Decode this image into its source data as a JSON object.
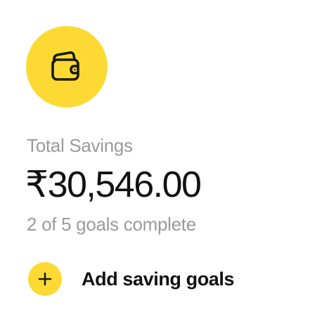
{
  "savings": {
    "icon": "wallet-icon",
    "label": "Total Savings",
    "amount": "₹30,546.00",
    "goals_completed": 2,
    "goals_total": 5,
    "goals_status": "2 of 5 goals complete"
  },
  "add_goal": {
    "icon": "plus-icon",
    "label": "Add saving goals"
  },
  "colors": {
    "accent": "#FDDA33",
    "text_primary": "#111111",
    "text_secondary": "#9A9A9A",
    "background": "#FFFFFF"
  }
}
